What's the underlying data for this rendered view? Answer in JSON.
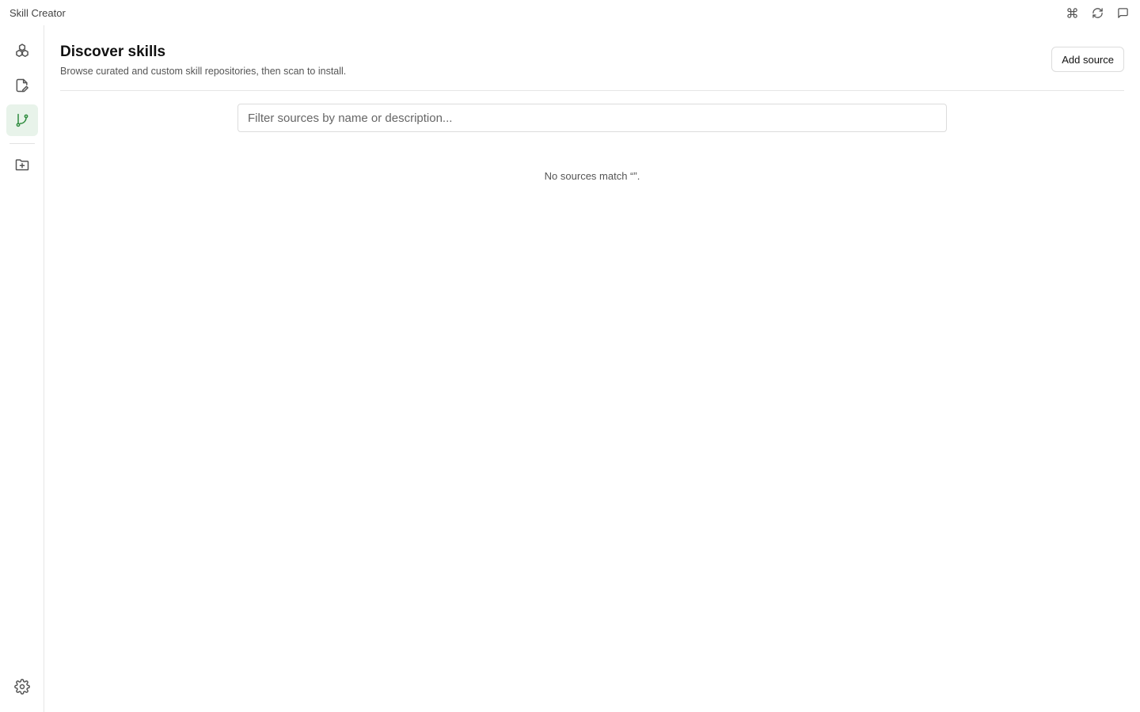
{
  "app": {
    "title": "Skill Creator"
  },
  "titlebar": {
    "actions": [
      {
        "icon": "command-icon"
      },
      {
        "icon": "refresh-icon"
      },
      {
        "icon": "feedback-icon"
      }
    ]
  },
  "sidebar": {
    "items": [
      {
        "icon": "skills-cubes-icon",
        "active": false
      },
      {
        "icon": "edit-document-icon",
        "active": false
      },
      {
        "icon": "git-branch-icon",
        "active": true
      },
      {
        "icon": "folder-plus-icon",
        "active": false
      },
      {
        "icon": "settings-gear-icon",
        "active": false
      }
    ]
  },
  "header": {
    "title": "Discover skills",
    "subtitle": "Browse curated and custom skill repositories, then scan to install.",
    "add_source_label": "Add source"
  },
  "search": {
    "placeholder": "Filter sources by name or description...",
    "value": ""
  },
  "empty_state": {
    "message": "No sources match “”."
  },
  "colors": {
    "accent": "#2e8b3e",
    "active_bg": "#e8f3ea",
    "border": "#e6e6e6",
    "text_muted": "#555555"
  }
}
